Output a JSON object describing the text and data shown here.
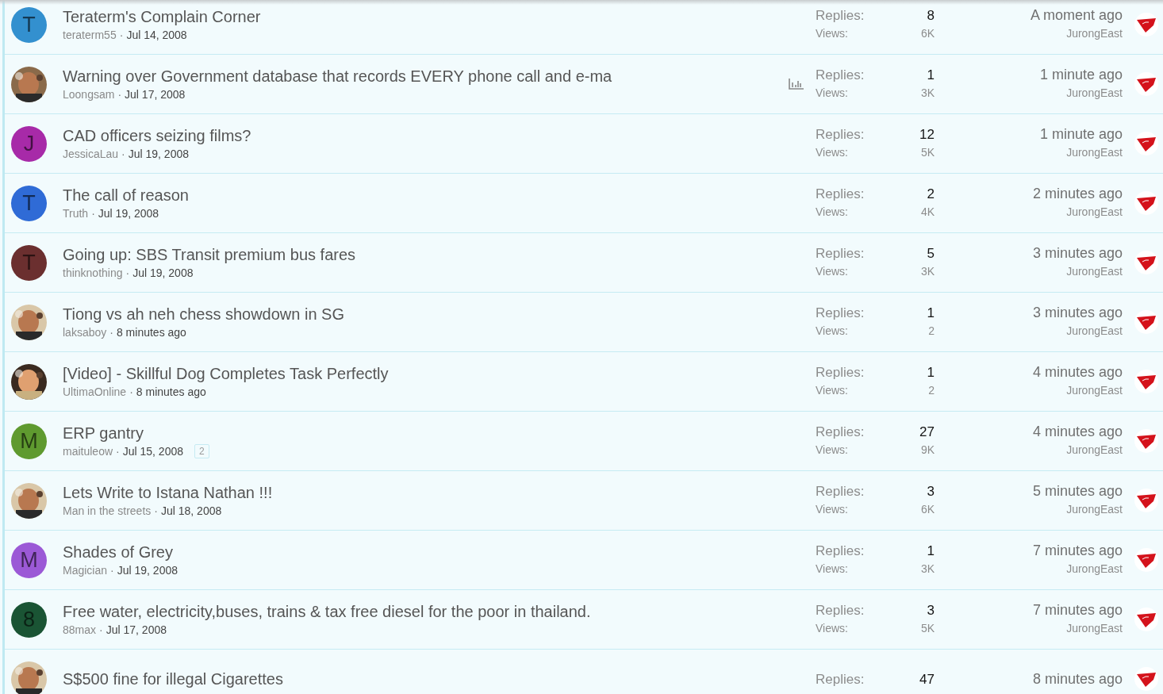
{
  "threads": [
    {
      "title": "Teraterm's Complain Corner",
      "author": "teraterm55",
      "separator": "·",
      "date": "Jul 14, 2008",
      "avatar": {
        "kind": "letter",
        "letter": "T",
        "color": "#3390cf"
      },
      "poll": false,
      "replies_label": "Replies:",
      "replies": "8",
      "views_label": "Views:",
      "views": "6K",
      "last_time": "A moment ago",
      "last_user": "JurongEast"
    },
    {
      "title": "Warning over Government database that records EVERY phone call and e-ma",
      "author": "Loongsam",
      "separator": "·",
      "date": "Jul 17, 2008",
      "poll": true,
      "replies_label": "Replies:",
      "replies": "1",
      "views_label": "Views:",
      "views": "3K",
      "last_time": "1 minute ago",
      "last_user": "JurongEast"
    },
    {
      "title": "CAD officers seizing films?",
      "author": "JessicaLau",
      "separator": "·",
      "date": "Jul 19, 2008",
      "avatar": {
        "kind": "letter",
        "letter": "J",
        "color": "#a72aa8"
      },
      "poll": false,
      "replies_label": "Replies:",
      "replies": "12",
      "views_label": "Views:",
      "views": "5K",
      "last_time": "1 minute ago",
      "last_user": "JurongEast"
    },
    {
      "title": "The call of reason",
      "author": "Truth",
      "separator": "·",
      "date": "Jul 19, 2008",
      "avatar": {
        "kind": "letter",
        "letter": "T",
        "color": "#2f6bd6"
      },
      "poll": false,
      "replies_label": "Replies:",
      "replies": "2",
      "views_label": "Views:",
      "views": "4K",
      "last_time": "2 minutes ago",
      "last_user": "JurongEast"
    },
    {
      "title": "Going up: SBS Transit premium bus fares",
      "author": "thinknothing",
      "separator": "·",
      "date": "Jul 19, 2008",
      "avatar": {
        "kind": "letter",
        "letter": "T",
        "color": "#6b2f2f"
      },
      "poll": false,
      "replies_label": "Replies:",
      "replies": "5",
      "views_label": "Views:",
      "views": "3K",
      "last_time": "3 minutes ago",
      "last_user": "JurongEast"
    },
    {
      "title": "Tiong vs ah neh chess showdown in SG",
      "author": "laksaboy",
      "separator": "·",
      "date": "8 minutes ago",
      "poll": false,
      "replies_label": "Replies:",
      "replies": "1",
      "views_label": "Views:",
      "views": "2",
      "last_time": "3 minutes ago",
      "last_user": "JurongEast"
    },
    {
      "title": "[Video] - Skillful Dog Completes Task Perfectly",
      "author": "UltimaOnline",
      "separator": "·",
      "date": "8 minutes ago",
      "poll": false,
      "replies_label": "Replies:",
      "replies": "1",
      "views_label": "Views:",
      "views": "2",
      "last_time": "4 minutes ago",
      "last_user": "JurongEast"
    },
    {
      "title": "ERP gantry",
      "author": "maituleow",
      "separator": "·",
      "date": "Jul 15, 2008",
      "page": "2",
      "avatar": {
        "kind": "letter",
        "letter": "M",
        "color": "#5f9a2f"
      },
      "poll": false,
      "replies_label": "Replies:",
      "replies": "27",
      "views_label": "Views:",
      "views": "9K",
      "last_time": "4 minutes ago",
      "last_user": "JurongEast"
    },
    {
      "title": "Lets Write to Istana Nathan !!!",
      "author": "Man in the streets",
      "separator": "·",
      "date": "Jul 18, 2008",
      "poll": false,
      "replies_label": "Replies:",
      "replies": "3",
      "views_label": "Views:",
      "views": "6K",
      "last_time": "5 minutes ago",
      "last_user": "JurongEast"
    },
    {
      "title": "Shades of Grey",
      "author": "Magician",
      "separator": "·",
      "date": "Jul 19, 2008",
      "avatar": {
        "kind": "letter",
        "letter": "M",
        "color": "#9b59d6"
      },
      "poll": false,
      "replies_label": "Replies:",
      "replies": "1",
      "views_label": "Views:",
      "views": "3K",
      "last_time": "7 minutes ago",
      "last_user": "JurongEast"
    },
    {
      "title": "Free water, electricity,buses, trains & tax free diesel for the poor in thailand.",
      "author": "88max",
      "separator": "·",
      "date": "Jul 17, 2008",
      "avatar": {
        "kind": "letter",
        "letter": "8",
        "color": "#1a5434"
      },
      "poll": false,
      "replies_label": "Replies:",
      "replies": "3",
      "views_label": "Views:",
      "views": "5K",
      "last_time": "7 minutes ago",
      "last_user": "JurongEast"
    },
    {
      "title": "S$500 fine for illegal Cigarettes",
      "poll": false,
      "replies_label": "Replies:",
      "replies": "47",
      "last_time": "8 minutes ago"
    }
  ]
}
